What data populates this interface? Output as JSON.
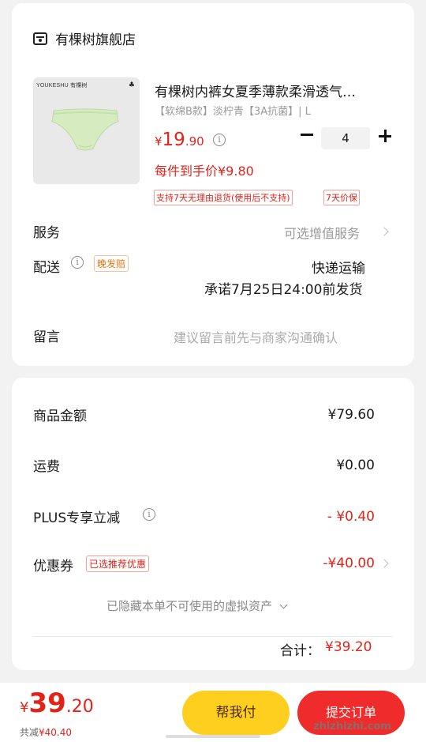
{
  "store": {
    "name": "有棵树旗舰店",
    "icon": "store-icon"
  },
  "product": {
    "brand": "YOUKESHU 有棵树",
    "title": "有棵树内裤女夏季薄款柔滑透气…",
    "spec": "【软绵B款】淡柠青【3A抗菌】| L",
    "price_symbol": "¥",
    "price_int": "19",
    "price_dec": ".90",
    "quantity": "4",
    "per_price": "每件到手价¥9.80",
    "tags": [
      "支持7天无理由退货(使用后不支持)",
      "7天价保"
    ],
    "image_color": "#d6ecc0"
  },
  "service": {
    "label": "服务",
    "value": "可选增值服务"
  },
  "shipping": {
    "label": "配送",
    "tag": "晚发赔",
    "method": "快递运输",
    "promise": "承诺7月25日24:00前发货"
  },
  "note": {
    "label": "留言",
    "placeholder": "建议留言前先与商家沟通确认"
  },
  "summary": {
    "rows": [
      {
        "label": "商品金额",
        "value": "¥79.60"
      },
      {
        "label": "运费",
        "value": "¥0.00"
      },
      {
        "label": "PLUS专享立减",
        "value": "- ¥0.40"
      },
      {
        "label": "优惠券",
        "value": "-¥40.00",
        "tag": "已选推荐优惠"
      }
    ],
    "hidden_assets": "已隐藏本单不可使用的虚拟资产",
    "total_label": "合计：",
    "total_value": "¥39.20"
  },
  "bottom_bar": {
    "price_symbol": "¥",
    "price_int": "39",
    "price_dec": ".20",
    "saved_label": "共减",
    "saved_value": "¥40.40",
    "help_pay": "帮我付",
    "submit": "提交订单"
  },
  "watermark": {
    "text": "zhizhizhi.com",
    "mark": "值"
  },
  "colors": {
    "accent_red": "#e2231a",
    "yellow_button": "#ffcf20",
    "red_button": "#f02b2b"
  }
}
